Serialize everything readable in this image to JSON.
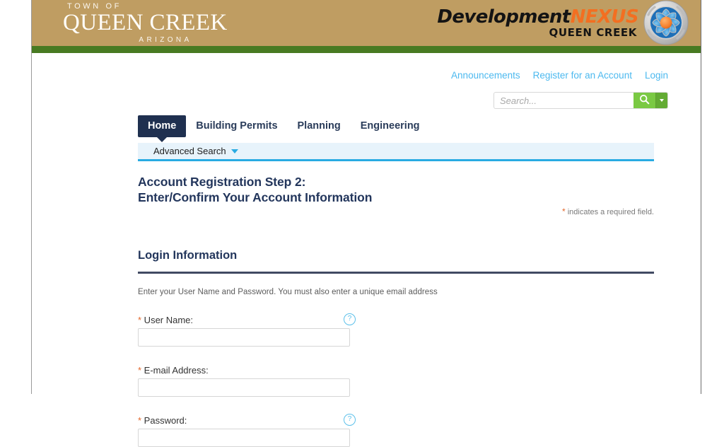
{
  "brand": {
    "town_line1": "TOWN OF",
    "town_line2": "QUEEN CREEK",
    "town_line3": "ARIZONA",
    "nexus_dev": "Development",
    "nexus_nex": "NEXUS",
    "nexus_sub": "QUEEN CREEK",
    "banner_color": "#bf9d62",
    "accent_green": "#487a22",
    "nexus_orange": "#f36f21"
  },
  "util_nav": {
    "items": [
      {
        "label": "Announcements"
      },
      {
        "label": "Register for an Account"
      },
      {
        "label": "Login"
      }
    ],
    "link_color": "#4cb9ef"
  },
  "search": {
    "value": "",
    "placeholder": "Search...",
    "button_icon": "search-icon",
    "dropdown_icon": "chevron-down-icon",
    "button_color": "#7ac943"
  },
  "tabs": [
    {
      "label": "Home",
      "active": true
    },
    {
      "label": "Building Permits",
      "active": false
    },
    {
      "label": "Planning",
      "active": false
    },
    {
      "label": "Engineering",
      "active": false
    }
  ],
  "advanced_search": {
    "label": "Advanced Search",
    "caret_icon": "chevron-down-icon",
    "bar_color": "#e7f3fb",
    "underline_color": "#29abe2"
  },
  "page": {
    "title_line1": "Account Registration Step 2:",
    "title_line2": "Enter/Confirm Your Account Information",
    "required_star": "*",
    "required_note": " indicates a required field.",
    "section_title": "Login Information",
    "section_desc": "Enter your User Name and Password.  You must also enter a unique email address"
  },
  "fields": [
    {
      "star": "*",
      "label": " User Name:",
      "value": "",
      "has_help": true,
      "help_glyph": "?"
    },
    {
      "star": "*",
      "label": " E-mail Address:",
      "value": "",
      "has_help": false,
      "help_glyph": "?"
    },
    {
      "star": "*",
      "label": " Password:",
      "value": "",
      "has_help": true,
      "help_glyph": "?"
    }
  ]
}
